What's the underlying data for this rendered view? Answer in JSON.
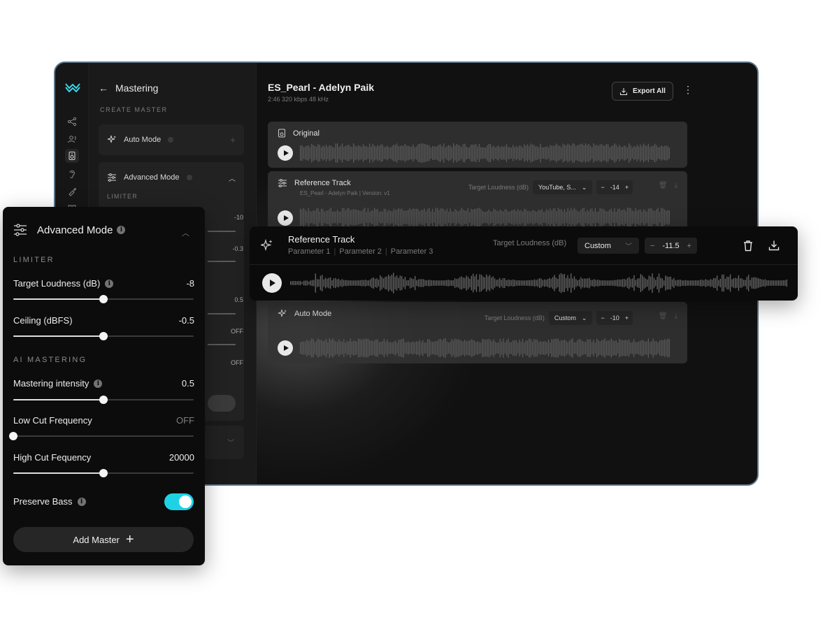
{
  "sidebar": {
    "icons": [
      "logo-icon",
      "share-icon",
      "users-icon",
      "speaker-icon",
      "ear-icon",
      "brush-icon",
      "grid-icon"
    ]
  },
  "panel": {
    "back_label": "Mastering",
    "caption": "CREATE MASTER",
    "auto_mode": {
      "label": "Auto Mode"
    },
    "advanced_mode": {
      "label": "Advanced Mode",
      "limiter_label": "LIMITER"
    },
    "bg_values": [
      "-10",
      "-0.3",
      "0.5",
      "OFF",
      "OFF"
    ]
  },
  "track": {
    "title": "ES_Pearl - Adelyn Paik",
    "meta": "2:46  320 kbps  48 kHz",
    "export_label": "Export All"
  },
  "cards": {
    "original": {
      "label": "Original"
    },
    "reference": {
      "label": "Reference Track",
      "sub": "ES_Pearl - Adelyn Paik  |  Version: v1",
      "tl_label": "Target Loudness (dB)",
      "select": "YouTube, S...",
      "value": "-14"
    },
    "auto": {
      "label": "Auto Mode",
      "tl_label": "Target Loudness (dB)",
      "select": "Custom",
      "value": "-10"
    }
  },
  "floating_reference": {
    "title": "Reference Track",
    "params": [
      "Parameter 1",
      "Parameter 2",
      "Parameter 3"
    ],
    "tl_label": "Target Loudness (dB)",
    "select": "Custom",
    "value": "-11.5"
  },
  "advanced_panel": {
    "title": "Advanced Mode",
    "limiter_section": "LIMITER",
    "ai_section": "AI MASTERING",
    "target_loudness": {
      "label": "Target Loudness (dB)",
      "value": "-8",
      "level": 0.5
    },
    "ceiling": {
      "label": "Ceiling (dBFS)",
      "value": "-0.5",
      "level": 0.5
    },
    "mastering_intensity": {
      "label": "Mastering intensity",
      "value": "0.5",
      "level": 0.5
    },
    "low_cut": {
      "label": "Low Cut Frequency",
      "value": "OFF",
      "level": 0.0
    },
    "high_cut": {
      "label": "High Cut Fequency",
      "value": "20000",
      "level": 0.5
    },
    "preserve_bass": {
      "label": "Preserve Bass",
      "on": true
    },
    "add_master_label": "Add Master"
  },
  "colors": {
    "accent": "#1ed2e6",
    "window_border": "#5d7689",
    "app_bg": "#131313"
  }
}
